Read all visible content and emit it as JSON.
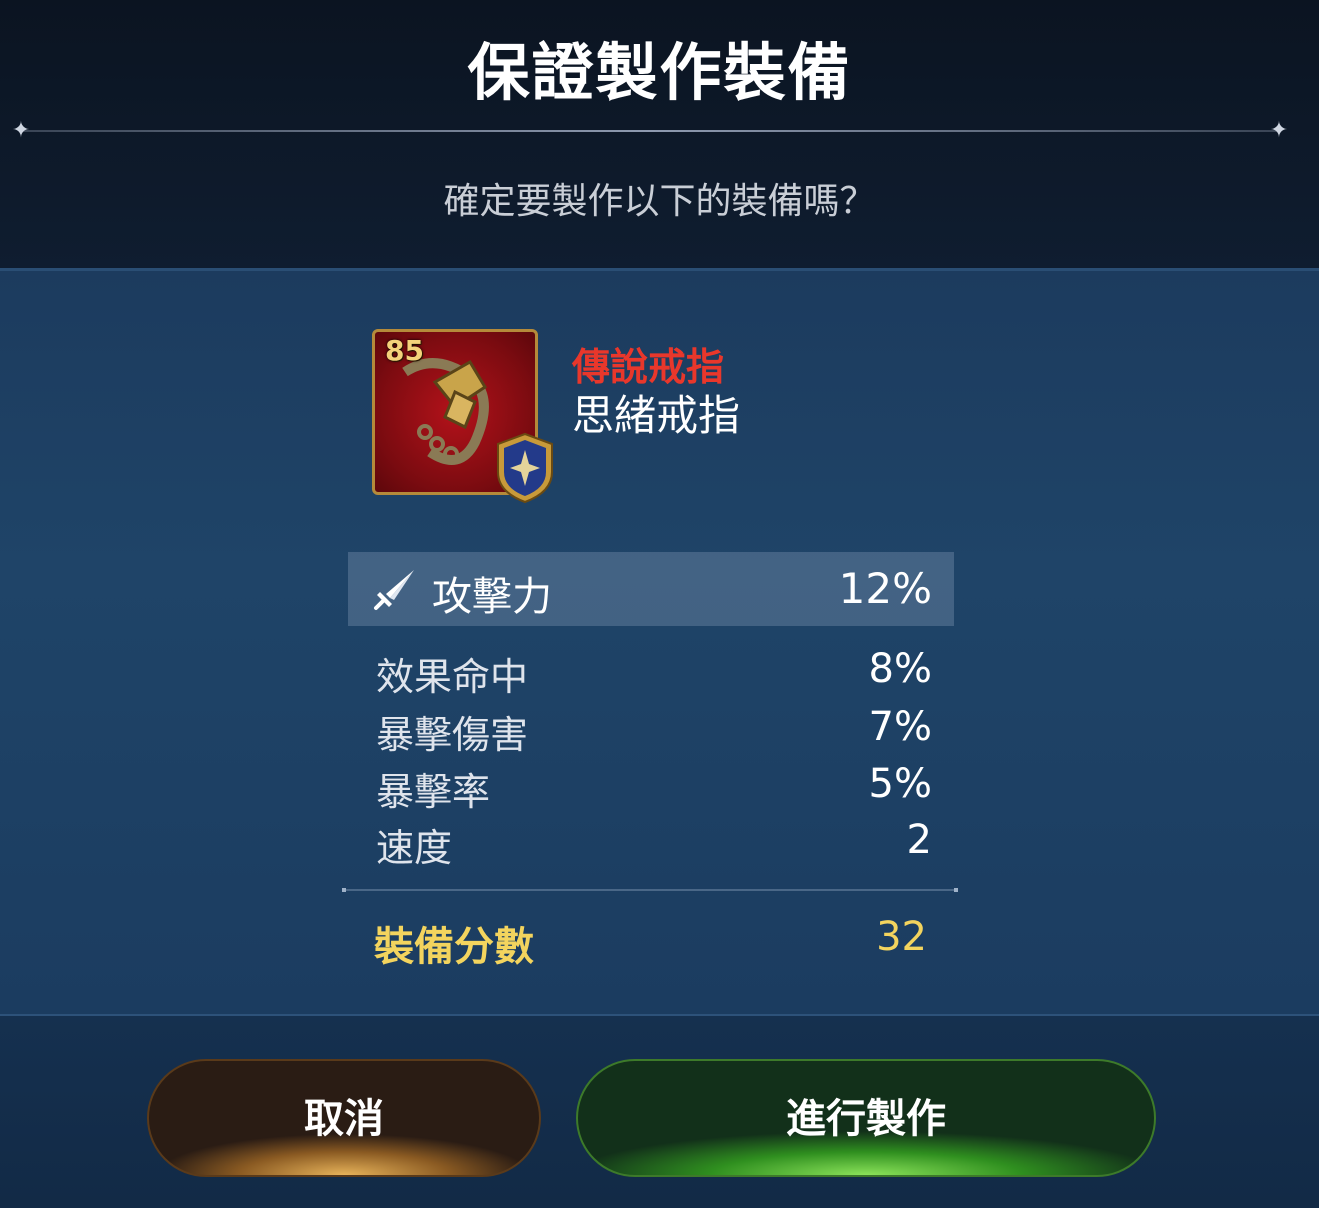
{
  "dialog": {
    "title": "保證製作裝備",
    "subtitle": "確定要製作以下的裝備嗎？"
  },
  "item": {
    "level": "85",
    "grade": "傳說戒指",
    "name": "思緒戒指",
    "grade_color": "#e9372b",
    "icon": "ring-icon",
    "class_icon": "class-badge-icon"
  },
  "main_stat": {
    "icon": "sword-icon",
    "label": "攻擊力",
    "value": "12%"
  },
  "sub_stats": [
    {
      "label": "效果命中",
      "value": "8%"
    },
    {
      "label": "暴擊傷害",
      "value": "7%"
    },
    {
      "label": "暴擊率",
      "value": "5%"
    },
    {
      "label": "速度",
      "value": "2"
    }
  ],
  "score": {
    "label": "裝備分數",
    "value": "32",
    "color": "#f3d45e"
  },
  "buttons": {
    "cancel": "取消",
    "craft": "進行製作"
  }
}
